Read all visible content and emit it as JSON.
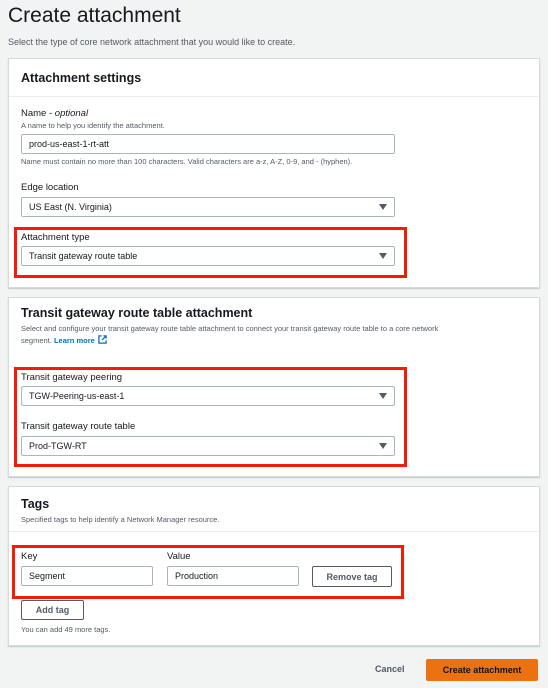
{
  "header": {
    "title": "Create attachment",
    "description": "Select the type of core network attachment that you would like to create."
  },
  "attachment_settings": {
    "title": "Attachment settings",
    "name_label": "Name - ",
    "name_optional": "optional",
    "name_hint": "A name to help you identify the attachment.",
    "name_value": "prod-us-east-1-rt-att",
    "name_constraint": "Name must contain no more than 100 characters. Valid characters are a-z, A-Z, 0-9, and - (hyphen).",
    "edge_location_label": "Edge location",
    "edge_location_value": "US East (N. Virginia)",
    "attachment_type_label": "Attachment type",
    "attachment_type_value": "Transit gateway route table"
  },
  "tgw_rt_attachment": {
    "title": "Transit gateway route table attachment",
    "description_line1": "Select and configure your transit gateway route table attachment to connect your transit gateway route table to a core network",
    "description_line2": "segment.",
    "learn_more": "Learn more",
    "peering_label": "Transit gateway peering",
    "peering_value": "TGW-Peering-us-east-1",
    "route_table_label": "Transit gateway route table",
    "route_table_value": "Prod-TGW-RT"
  },
  "tags": {
    "title": "Tags",
    "description": "Specified tags to help identify a Network Manager resource.",
    "key_label": "Key",
    "value_label": "Value",
    "items": [
      {
        "key": "Segment",
        "value": "Production"
      }
    ],
    "remove_label": "Remove tag",
    "add_label": "Add tag",
    "remaining_hint": "You can add 49 more tags."
  },
  "footer": {
    "cancel_label": "Cancel",
    "create_label": "Create attachment"
  },
  "colors": {
    "accent": "#ec7211",
    "link": "#0073bb",
    "highlight": "#f41b08"
  },
  "icons": [
    "caret-down-icon",
    "external-link-icon"
  ]
}
